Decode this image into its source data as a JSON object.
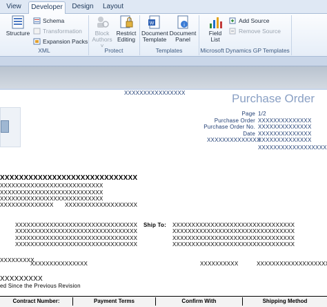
{
  "ribbon": {
    "tabs": [
      {
        "label": "View",
        "active": false
      },
      {
        "label": "Developer",
        "active": true
      },
      {
        "label": "Design",
        "active": false
      },
      {
        "label": "Layout",
        "active": false
      }
    ],
    "xml_group": {
      "label": "XML",
      "structure": "Structure",
      "schema": "Schema",
      "transformation": "Transformation",
      "expansion_packs": "Expansion Packs"
    },
    "protect_group": {
      "label": "Protect",
      "block_authors_line1": "Block",
      "block_authors_line2": "Authors ˅",
      "restrict_editing_line1": "Restrict",
      "restrict_editing_line2": "Editing"
    },
    "templates_group": {
      "label": "Templates",
      "document_template_line1": "Document",
      "document_template_line2": "Template",
      "document_panel_line1": "Document",
      "document_panel_line2": "Panel"
    },
    "gp_group": {
      "label": "Microsoft Dynamics GP Templates",
      "field_list_line1": "Field",
      "field_list_line2": "List",
      "add_source": "Add Source",
      "remove_source": "Remove Source"
    }
  },
  "document": {
    "header_company": "XXXXXXXXXXXXXXXX",
    "title": "Purchase Order",
    "labels": {
      "page": "Page",
      "purchase_order": "Purchase Order",
      "purchase_order_no": "Purchase Order No.",
      "date": "Date",
      "extra_label": "XXXXXXXXXXXXXX"
    },
    "values": {
      "page": "1/2",
      "purchase_order": "XXXXXXXXXXXXXX",
      "purchase_order_no": "XXXXXXXXXXXXXX",
      "date": "XXXXXXXXXXXXXX",
      "extra_value": "XXXXXXXXXXXXXX",
      "extra_value2": "XXXXXXXXXXXXXXXXXXXX"
    },
    "vendor": {
      "name": "XXXXXXXXXXXXXXXXXXXXXXXXXXXXX",
      "line1": "XXXXXXXXXXXXXXXXXXXXXXXXXXX",
      "line2": "XXXXXXXXXXXXXXXXXXXXXXXXXXX",
      "line3": "XXXXXXXXXXXXXXXXXXXXXXXXXXX",
      "line4a": "XXXXXXXXXXXXXX",
      "line4b": "XXXXXXXXXXXXXXXXXXX"
    },
    "bill_to": [
      "XXXXXXXXXXXXXXXXXXXXXXXXXXXXXXXX",
      "XXXXXXXXXXXXXXXXXXXXXXXXXXXXXXXX",
      "XXXXXXXXXXXXXXXXXXXXXXXXXXXXXXXX",
      "XXXXXXXXXXXXXXXXXXXXXXXXXXXXXXXX"
    ],
    "ship_to_label": "Ship To:",
    "ship_to": [
      "XXXXXXXXXXXXXXXXXXXXXXXXXXXXXXXX",
      "XXXXXXXXXXXXXXXXXXXXXXXXXXXXXXXX",
      "XXXXXXXXXXXXXXXXXXXXXXXXXXXXXXXX",
      "XXXXXXXXXXXXXXXXXXXXXXXXXXXXXXXX"
    ],
    "misc": {
      "a": "XXXXXXXXX",
      "b": "XXXXXXXXXXXXXXXXXXXXXX",
      "c": "XXXXXXXXXXXXXXX",
      "d": "XXXXXXXXXXXXXXXXXXX",
      "e": "XXXXXXXXXX",
      "revision_note": "ed Since the Previous Revision"
    },
    "table_headers": [
      "Contract Number:",
      "Payment Terms",
      "Confirm With",
      "Shipping Method"
    ]
  }
}
